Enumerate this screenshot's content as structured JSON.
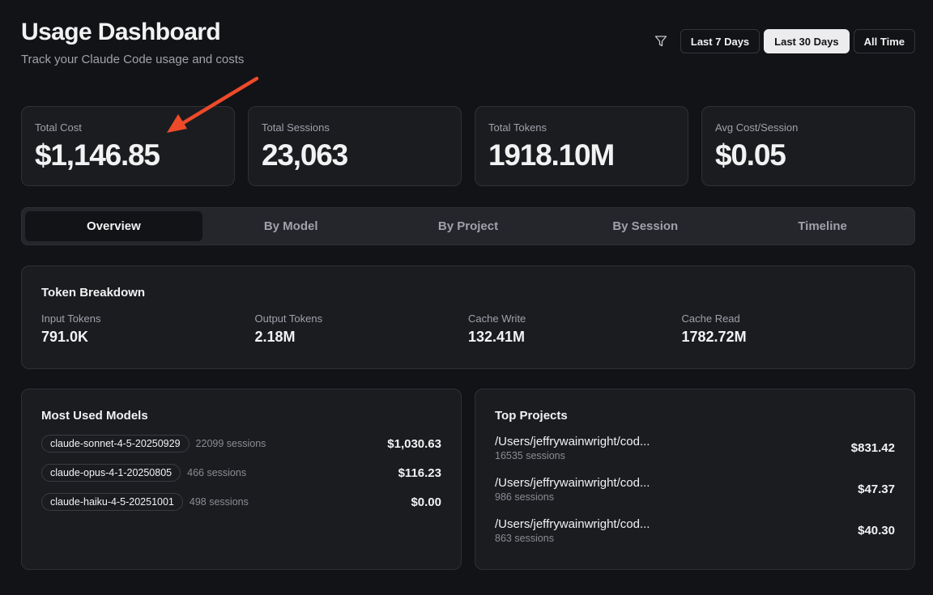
{
  "header": {
    "title": "Usage Dashboard",
    "subtitle": "Track your Claude Code usage and costs"
  },
  "range_filter": {
    "icon": "filter-icon",
    "options": [
      "Last 7 Days",
      "Last 30 Days",
      "All Time"
    ],
    "selected": "Last 30 Days"
  },
  "stats": [
    {
      "label": "Total Cost",
      "value": "$1,146.85"
    },
    {
      "label": "Total Sessions",
      "value": "23,063"
    },
    {
      "label": "Total Tokens",
      "value": "1918.10M"
    },
    {
      "label": "Avg Cost/Session",
      "value": "$0.05"
    }
  ],
  "tabs": [
    {
      "label": "Overview",
      "active": true
    },
    {
      "label": "By Model",
      "active": false
    },
    {
      "label": "By Project",
      "active": false
    },
    {
      "label": "By Session",
      "active": false
    },
    {
      "label": "Timeline",
      "active": false
    }
  ],
  "token_breakdown": {
    "title": "Token Breakdown",
    "items": [
      {
        "label": "Input Tokens",
        "value": "791.0K"
      },
      {
        "label": "Output Tokens",
        "value": "2.18M"
      },
      {
        "label": "Cache Write",
        "value": "132.41M"
      },
      {
        "label": "Cache Read",
        "value": "1782.72M"
      }
    ]
  },
  "models": {
    "title": "Most Used Models",
    "rows": [
      {
        "name": "claude-sonnet-4-5-20250929",
        "sessions": "22099 sessions",
        "cost": "$1,030.63"
      },
      {
        "name": "claude-opus-4-1-20250805",
        "sessions": "466 sessions",
        "cost": "$116.23"
      },
      {
        "name": "claude-haiku-4-5-20251001",
        "sessions": "498 sessions",
        "cost": "$0.00"
      }
    ]
  },
  "projects": {
    "title": "Top Projects",
    "rows": [
      {
        "path": "/Users/jeffrywainwright/cod...",
        "sessions": "16535 sessions",
        "cost": "$831.42"
      },
      {
        "path": "/Users/jeffrywainwright/cod...",
        "sessions": "986 sessions",
        "cost": "$47.37"
      },
      {
        "path": "/Users/jeffrywainwright/cod...",
        "sessions": "863 sessions",
        "cost": "$40.30"
      }
    ]
  },
  "annotation": {
    "arrow_color": "#ee4a2a"
  },
  "colors": {
    "background": "#121316",
    "card": "#1b1c20",
    "border": "#2f3036",
    "text": "#f2f2f3",
    "muted": "#a1a1aa",
    "active_button": "#ececee"
  }
}
